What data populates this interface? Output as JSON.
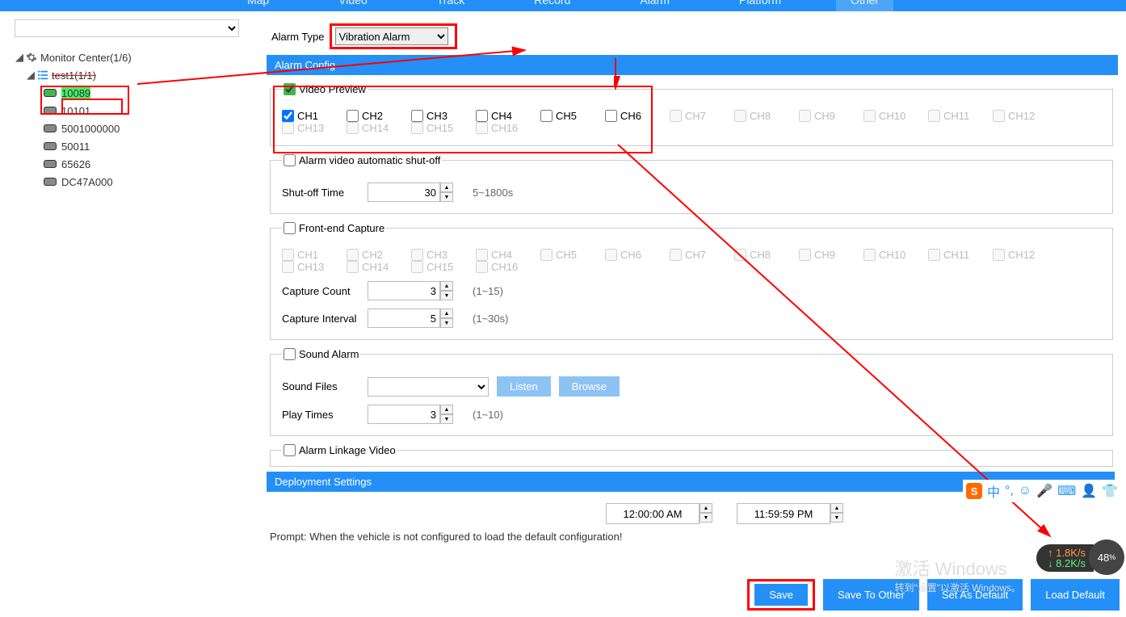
{
  "tabs": {
    "map": "Map",
    "video": "Video",
    "track": "Track",
    "record": "Record",
    "alarm": "Alarm",
    "platform": "Platform",
    "other": "Other"
  },
  "tree": {
    "root": "Monitor Center(1/6)",
    "group": "test1(1/1)",
    "devices": [
      "10089",
      "10101",
      "5001000000",
      "50011",
      "65626",
      "DC47A000"
    ]
  },
  "alarmTypeLabel": "Alarm Type",
  "alarmTypeValue": "Vibration Alarm",
  "sections": {
    "alarmConfig": "Alarm Config",
    "deploy": "Deployment Settings"
  },
  "videoPreview": {
    "legend": "Video Preview",
    "channels": [
      "CH1",
      "CH2",
      "CH3",
      "CH4",
      "CH5",
      "CH6",
      "CH7",
      "CH8",
      "CH9",
      "CH10",
      "CH11",
      "CH12",
      "CH13",
      "CH14",
      "CH15",
      "CH16"
    ],
    "checked": [
      true,
      false,
      false,
      false,
      false,
      false,
      false,
      false,
      false,
      false,
      false,
      false,
      false,
      false,
      false,
      false
    ],
    "disabledFrom": 6
  },
  "autoShutoff": {
    "legend": "Alarm video automatic shut-off",
    "label": "Shut-off Time",
    "value": "30",
    "hint": "5~1800s"
  },
  "frontCapture": {
    "legend": "Front-end Capture",
    "countLabel": "Capture Count",
    "countValue": "3",
    "countHint": "(1~15)",
    "intervalLabel": "Capture Interval",
    "intervalValue": "5",
    "intervalHint": "(1~30s)"
  },
  "soundAlarm": {
    "legend": "Sound Alarm",
    "filesLabel": "Sound Files",
    "listen": "Listen",
    "browse": "Browse",
    "playLabel": "Play Times",
    "playValue": "3",
    "playHint": "(1~10)"
  },
  "linkage": {
    "legend": "Alarm Linkage Video"
  },
  "deploy": {
    "from": "12:00:00 AM",
    "to": "11:59:59 PM"
  },
  "prompt": "Prompt:  When the vehicle is not configured to load the default configuration!",
  "buttons": {
    "save": "Save",
    "saveOther": "Save To Other",
    "setDefault": "Set As Default",
    "loadDefault": "Load Default"
  },
  "watermark": {
    "l1": "激活 Windows",
    "l2": "转到\"设置\"以激活 Windows。"
  },
  "ime": {
    "s": "S",
    "zh": "中",
    "punc": "'",
    "smile": "☺",
    "mic": "🎤",
    "kbd": "⌨",
    "user": "👤",
    "shirt": "👕"
  },
  "net": {
    "up": "1.8K/s",
    "dn": "8.2K/s",
    "pct": "48"
  }
}
